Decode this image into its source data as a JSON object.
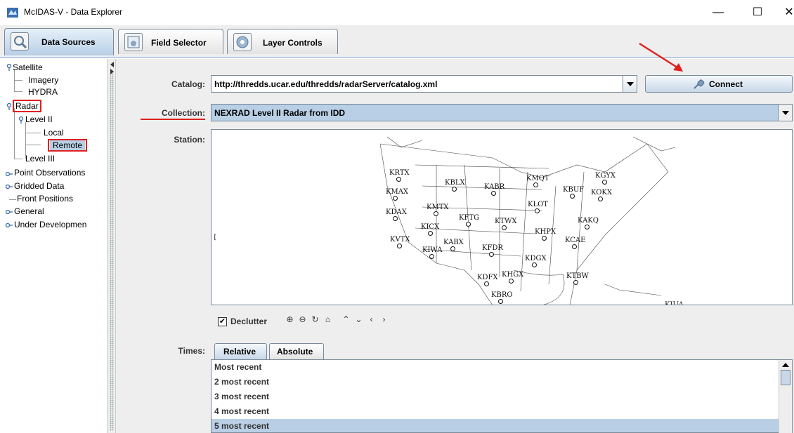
{
  "window": {
    "title": "McIDAS-V - Data Explorer",
    "minimize": "—",
    "maximize": "☐",
    "close": "✕"
  },
  "tabs": [
    {
      "label": "Data Sources",
      "active": true
    },
    {
      "label": "Field Selector",
      "active": false
    },
    {
      "label": "Layer Controls",
      "active": false
    }
  ],
  "tree": {
    "satellite": "Satellite",
    "imagery": "Imagery",
    "hydra": "HYDRA",
    "radar": "Radar",
    "level2": "Level II",
    "local": "Local",
    "remote": "Remote",
    "level3": "Level III",
    "point_obs": "Point Observations",
    "gridded": "Gridded Data",
    "front_positions": "Front Positions",
    "general": "General",
    "under_dev": "Under Developmen"
  },
  "form": {
    "catalog_label": "Catalog:",
    "catalog_value": "http://thredds.ucar.edu/thredds/radarServer/catalog.xml",
    "connect_label": "Connect",
    "collection_label": "Collection:",
    "collection_value": "NEXRAD Level II Radar from IDD",
    "station_label": "Station:",
    "declutter_label": "Declutter",
    "declutter_checked": true,
    "times_label": "Times:"
  },
  "stations": [
    "KRTX",
    "KBLX",
    "KABR",
    "KMQT",
    "KGYX",
    "KMAX",
    "KBUF",
    "KOKX",
    "KMTX",
    "KLOT",
    "KDAX",
    "KFTG",
    "KTWX",
    "KAKQ",
    "KICX",
    "KHPX",
    "KVTX",
    "KABX",
    "KCAE",
    "KIWA",
    "KFDR",
    "KDGX",
    "KDFX",
    "KHGX",
    "KTBW",
    "KBRO",
    "KJUA"
  ],
  "times_tabs": [
    {
      "label": "Relative",
      "active": true
    },
    {
      "label": "Absolute",
      "active": false
    }
  ],
  "times": [
    {
      "label": "Most recent",
      "selected": false
    },
    {
      "label": "2 most recent",
      "selected": false
    },
    {
      "label": "3 most recent",
      "selected": false
    },
    {
      "label": "4 most recent",
      "selected": false
    },
    {
      "label": "5 most recent",
      "selected": true
    }
  ],
  "colors": {
    "accent": "#b8cfe5",
    "highlight_red": "#e02020",
    "panel_bg": "#eeeeee"
  }
}
